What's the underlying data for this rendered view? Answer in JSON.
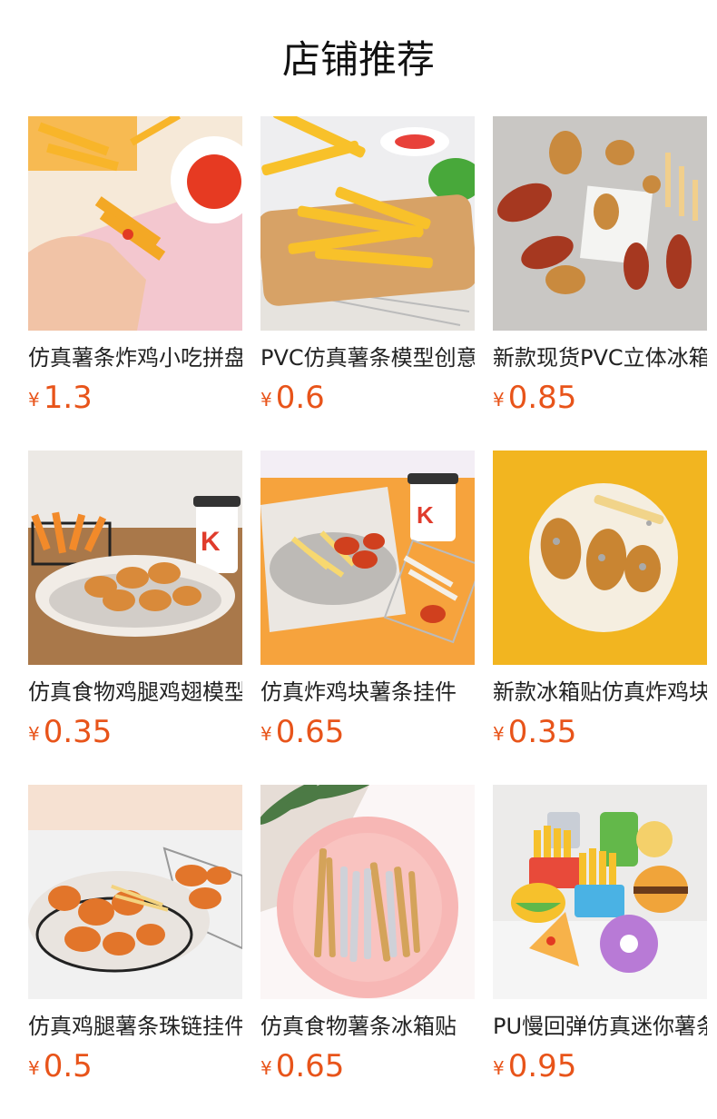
{
  "section": {
    "title": "店铺推荐"
  },
  "currency_symbol": "¥",
  "products": [
    {
      "name": "仿真薯条炸鸡小吃拼盘",
      "price": "1.3",
      "image": "fries-hand-photo"
    },
    {
      "name": "PVC仿真薯条模型创意",
      "price": "0.6",
      "image": "crinkle-fries-board-photo"
    },
    {
      "name": "新款现货PVC立体冰箱贴",
      "price": "0.85",
      "image": "fried-chicken-magnets-photo"
    },
    {
      "name": "仿真食物鸡腿鸡翅模型",
      "price": "0.35",
      "image": "chicken-basket-coffee-photo"
    },
    {
      "name": "仿真炸鸡块薯条挂件",
      "price": "0.65",
      "image": "nuggets-fries-rack-photo"
    },
    {
      "name": "新款冰箱贴仿真炸鸡块",
      "price": "0.35",
      "image": "nuggets-plate-yellow-photo"
    },
    {
      "name": "仿真鸡腿薯条珠链挂件",
      "price": "0.5",
      "image": "drumsticks-basket-photo"
    },
    {
      "name": "仿真食物薯条冰箱贴",
      "price": "0.65",
      "image": "fries-pink-plate-photo"
    },
    {
      "name": "PU慢回弹仿真迷你薯条",
      "price": "0.95",
      "image": "squishy-food-toys-photo"
    }
  ]
}
